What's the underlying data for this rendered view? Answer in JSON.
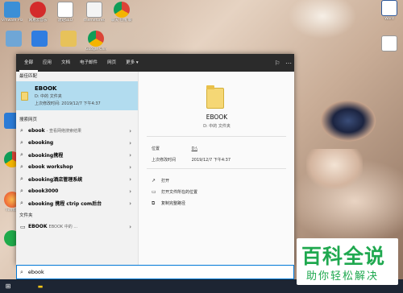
{
  "desktop": {
    "icons": [
      {
        "label": "Vmware Player"
      },
      {
        "label": "网易云音乐"
      },
      {
        "label": "建站SEO"
      },
      {
        "label": "themeforest 聚划算 工单查询"
      },
      {
        "label": "聊天 在线 聊天记录"
      },
      {
        "label": "Word"
      },
      {
        "label": "Google Chrome"
      },
      {
        "label": "Firefox"
      },
      {
        "label": "ToDesk"
      },
      {
        "label": "Edge"
      },
      {
        "label": "iQIYI"
      }
    ]
  },
  "tabs": [
    {
      "label": "全部",
      "active": true
    },
    {
      "label": "应用"
    },
    {
      "label": "文档"
    },
    {
      "label": "电子邮件"
    },
    {
      "label": "网页"
    },
    {
      "label": "更多 ▾"
    }
  ],
  "left": {
    "best_match_heading": "最佳匹配",
    "best_match": {
      "name": "EBOOK",
      "location": "D: 中的 文件夹",
      "modified": "上次修改时间: 2019/12/7 下午4:37"
    },
    "web_heading": "搜索网页",
    "web_results": [
      {
        "text": "ebook",
        "sub": "- 查看网络搜索结果"
      },
      {
        "text": "ebooking",
        "sub": ""
      },
      {
        "text": "ebooking携程",
        "sub": ""
      },
      {
        "text": "ebook workshop",
        "sub": ""
      },
      {
        "text": "ebooking酒店管理系统",
        "sub": ""
      },
      {
        "text": "ebook3000",
        "sub": ""
      },
      {
        "text": "ebooking 携程 ctrip com后台",
        "sub": ""
      }
    ],
    "folders_heading": "文件夹",
    "folder_results": [
      {
        "text": "EBOOK",
        "sub": "EBOOK 中的 ..."
      }
    ]
  },
  "right": {
    "title": "EBOOK",
    "subtitle": "D: 中的 文件夹",
    "location_label": "位置",
    "location_value": "D:\\",
    "modified_label": "上次修改时间",
    "modified_value": "2019/12/7 下午4:37",
    "actions": [
      {
        "icon": "open-icon",
        "label": "打开"
      },
      {
        "icon": "folder-icon",
        "label": "打开文件所在的位置"
      },
      {
        "icon": "copy-icon",
        "label": "复制完整路径"
      }
    ]
  },
  "search": {
    "value": "ebook"
  },
  "watermark": {
    "big": "百科全说",
    "small": "助你轻松解决"
  },
  "colors": {
    "accent": "#0078d7",
    "selection": "#b2dcef",
    "topbar": "#2b2b2b",
    "taskbar": "#1d2533",
    "watermark": "#1fa84f"
  }
}
